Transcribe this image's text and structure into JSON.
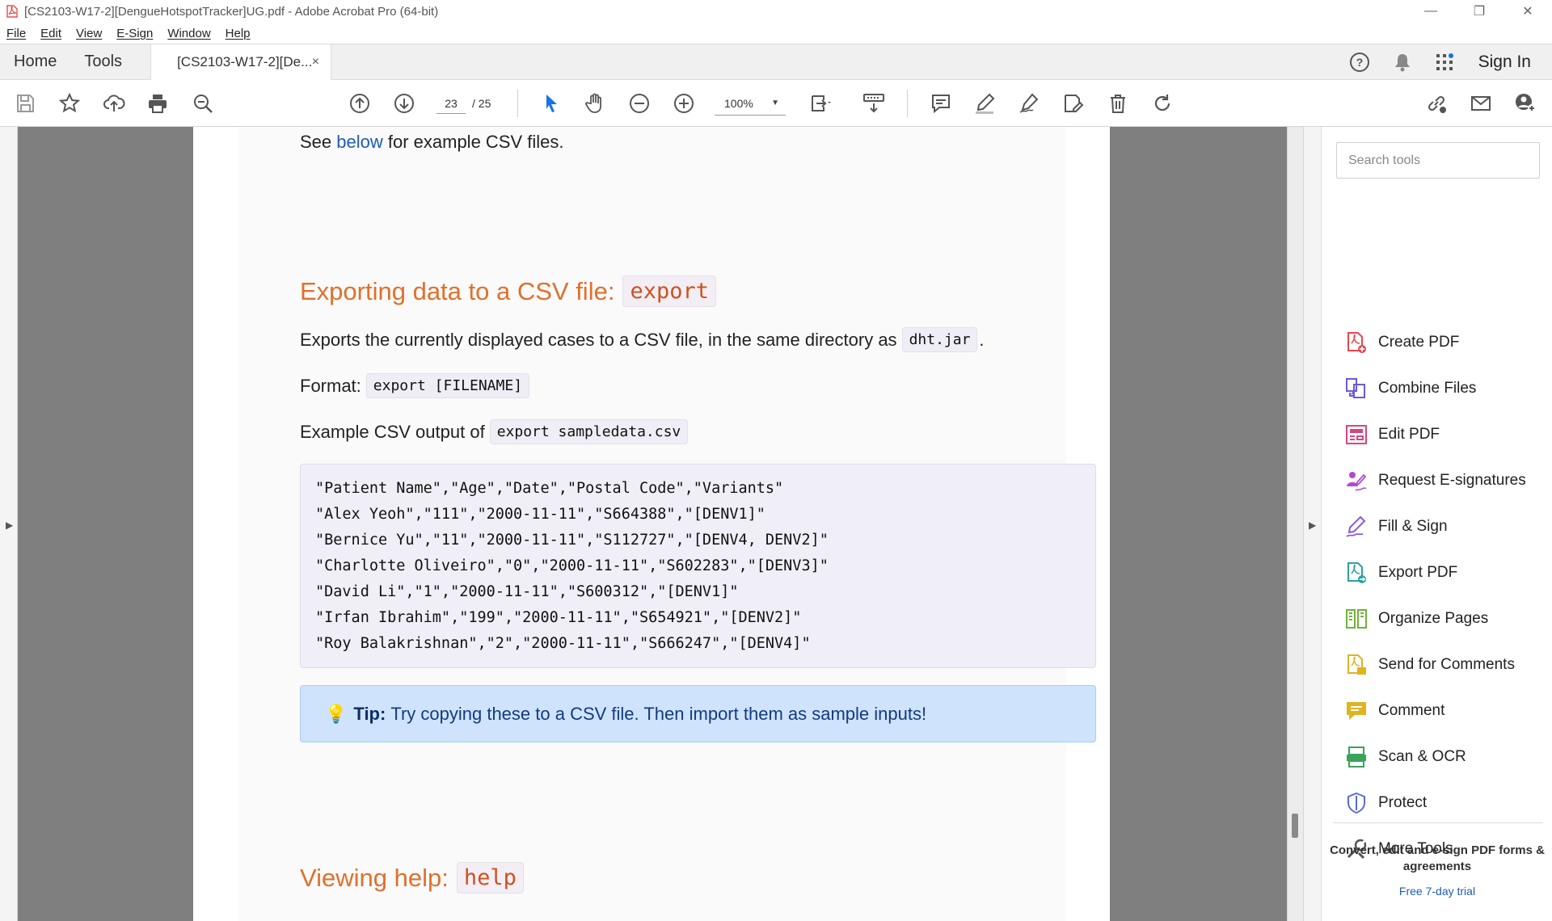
{
  "window": {
    "title": "[CS2103-W17-2][DengueHotspotTracker]UG.pdf - Adobe Acrobat Pro (64-bit)"
  },
  "menu": [
    "File",
    "Edit",
    "View",
    "E-Sign",
    "Window",
    "Help"
  ],
  "tabs": {
    "home": "Home",
    "tools": "Tools",
    "document": "[CS2103-W17-2][De...",
    "close": "×"
  },
  "header": {
    "sign_in": "Sign In"
  },
  "toolbar": {
    "current_page": "23",
    "total_pages": "/ 25",
    "zoom": "100%"
  },
  "document": {
    "see_prefix": "See ",
    "see_link": "below",
    "see_suffix": " for example CSV files.",
    "export_heading": "Exporting data to a CSV file:",
    "export_heading_code": "export",
    "export_desc": "Exports the currently displayed cases to a CSV file, in the same directory as",
    "export_desc_code": "dht.jar",
    "export_desc_end": ".",
    "format_label": "Format:",
    "format_code": "export [FILENAME]",
    "example_label": "Example CSV output of",
    "example_code": "export sampledata.csv",
    "csv_lines": [
      "\"Patient Name\",\"Age\",\"Date\",\"Postal Code\",\"Variants\"",
      "\"Alex Yeoh\",\"111\",\"2000-11-11\",\"S664388\",\"[DENV1]\"",
      "\"Bernice Yu\",\"11\",\"2000-11-11\",\"S112727\",\"[DENV4, DENV2]\"",
      "\"Charlotte Oliveiro\",\"0\",\"2000-11-11\",\"S602283\",\"[DENV3]\"",
      "\"David Li\",\"1\",\"2000-11-11\",\"S600312\",\"[DENV1]\"",
      "\"Irfan Ibrahim\",\"199\",\"2000-11-11\",\"S654921\",\"[DENV2]\"",
      "\"Roy Balakrishnan\",\"2\",\"2000-11-11\",\"S666247\",\"[DENV4]\""
    ],
    "tip_label": "Tip:",
    "tip_text": "Try copying these to a CSV file. Then import them as sample inputs!",
    "help_heading": "Viewing help:",
    "help_heading_code": "help"
  },
  "tools_pane": {
    "search_placeholder": "Search tools",
    "items": [
      {
        "label": "Create PDF",
        "icon": "create-pdf-icon",
        "color": "#e34850"
      },
      {
        "label": "Combine Files",
        "icon": "combine-files-icon",
        "color": "#6a5ad9"
      },
      {
        "label": "Edit PDF",
        "icon": "edit-pdf-icon",
        "color": "#d9457c"
      },
      {
        "label": "Request E-signatures",
        "icon": "request-esign-icon",
        "color": "#b24ad1"
      },
      {
        "label": "Fill & Sign",
        "icon": "fill-sign-icon",
        "color": "#8a5ad9"
      },
      {
        "label": "Export PDF",
        "icon": "export-pdf-icon",
        "color": "#2ba39b"
      },
      {
        "label": "Organize Pages",
        "icon": "organize-pages-icon",
        "color": "#6fb33a"
      },
      {
        "label": "Send for Comments",
        "icon": "send-comments-icon",
        "color": "#e0b321"
      },
      {
        "label": "Comment",
        "icon": "comment-icon",
        "color": "#e0b321"
      },
      {
        "label": "Scan & OCR",
        "icon": "scan-ocr-icon",
        "color": "#3aa35a"
      },
      {
        "label": "Protect",
        "icon": "protect-icon",
        "color": "#5a6ad9"
      },
      {
        "label": "More Tools",
        "icon": "more-tools-icon",
        "color": "#555555"
      }
    ],
    "promo": "Convert, edit and e-sign PDF forms & agreements",
    "trial": "Free 7-day trial"
  }
}
